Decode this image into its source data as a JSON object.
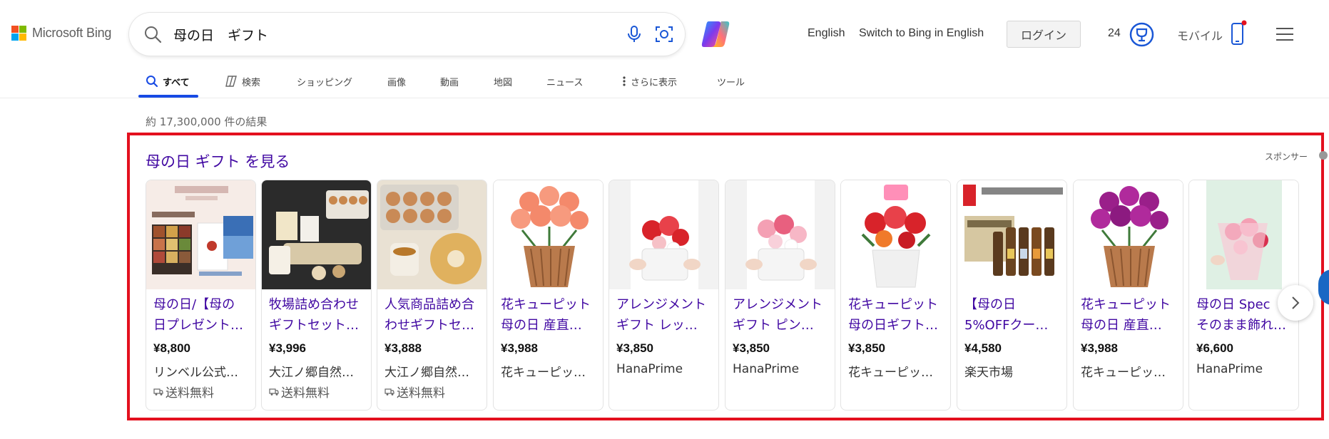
{
  "header": {
    "logo_text": "Microsoft Bing",
    "search_query": "母の日　ギフト",
    "links": {
      "english": "English",
      "switch": "Switch to Bing in English"
    },
    "login_label": "ログイン",
    "reward_count": "24",
    "mobile_label": "モバイル"
  },
  "nav": {
    "items": [
      {
        "label": "すべて"
      },
      {
        "label": "検索"
      },
      {
        "label": "ショッピング"
      },
      {
        "label": "画像"
      },
      {
        "label": "動画"
      },
      {
        "label": "地図"
      },
      {
        "label": "ニュース"
      },
      {
        "label": "さらに表示"
      },
      {
        "label": "ツール"
      }
    ]
  },
  "results": {
    "count_text": "約 17,300,000 件の結果"
  },
  "shopping": {
    "title": "母の日 ギフト を見る",
    "sponsor_label": "スポンサー",
    "cards": [
      {
        "title_1": "母の日/【母の",
        "title_2": "日プレゼント…",
        "price": "¥8,800",
        "seller": "リンベル公式…",
        "shipping": "送料無料"
      },
      {
        "title_1": "牧場詰め合わせ",
        "title_2": "ギフトセット…",
        "price": "¥3,996",
        "seller": "大江ノ郷自然…",
        "shipping": "送料無料"
      },
      {
        "title_1": "人気商品詰め合",
        "title_2": "わせギフトセ…",
        "price": "¥3,888",
        "seller": "大江ノ郷自然…",
        "shipping": "送料無料"
      },
      {
        "title_1": "花キューピット",
        "title_2": "母の日 産直…",
        "price": "¥3,988",
        "seller": "花キューピッ…",
        "shipping": ""
      },
      {
        "title_1": "アレンジメント",
        "title_2": "ギフト レッ…",
        "price": "¥3,850",
        "seller": "HanaPrime",
        "shipping": ""
      },
      {
        "title_1": "アレンジメント",
        "title_2": "ギフト ピン…",
        "price": "¥3,850",
        "seller": "HanaPrime",
        "shipping": ""
      },
      {
        "title_1": "花キューピット",
        "title_2": "母の日ギフト…",
        "price": "¥3,850",
        "seller": "花キューピッ…",
        "shipping": ""
      },
      {
        "title_1": "【母の日",
        "title_2": "5%OFFクー…",
        "price": "¥4,580",
        "seller": "楽天市場",
        "shipping": ""
      },
      {
        "title_1": "花キューピット",
        "title_2": "母の日 産直…",
        "price": "¥3,988",
        "seller": "花キューピッ…",
        "shipping": ""
      },
      {
        "title_1": "母の日 Spec",
        "title_2": "そのまま飾れ…",
        "price": "¥6,600",
        "seller": "HanaPrime",
        "shipping": ""
      }
    ]
  },
  "colors": {
    "title_purple": "#4007a2",
    "accent_blue": "#174ae4",
    "ad_frame_red": "#e3101e"
  }
}
